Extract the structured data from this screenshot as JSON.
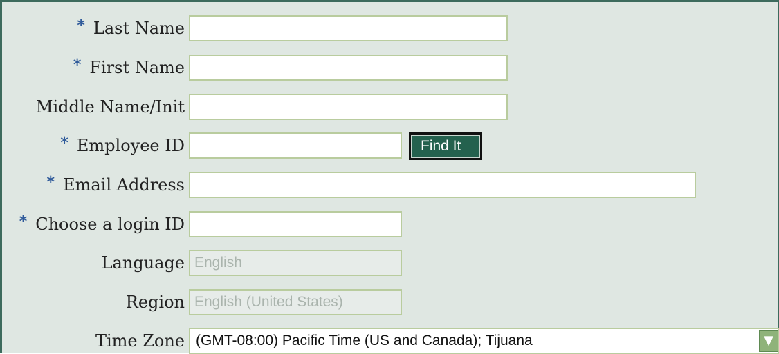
{
  "form": {
    "required_marker": "*",
    "last_name": {
      "label": "Last Name",
      "value": ""
    },
    "first_name": {
      "label": "First Name",
      "value": ""
    },
    "middle_name": {
      "label": "Middle Name/Init",
      "value": ""
    },
    "employee_id": {
      "label": "Employee ID",
      "value": "",
      "find_button": "Find It"
    },
    "email": {
      "label": "Email Address",
      "value": ""
    },
    "login_id": {
      "label": "Choose a login ID",
      "value": ""
    },
    "language": {
      "label": "Language",
      "value": "English"
    },
    "region": {
      "label": "Region",
      "value": "English (United States)"
    },
    "time_zone": {
      "label": "Time Zone",
      "value": "(GMT-08:00) Pacific Time (US and Canada); Tijuana",
      "dropdown_icon": "chevron-down-icon"
    }
  }
}
